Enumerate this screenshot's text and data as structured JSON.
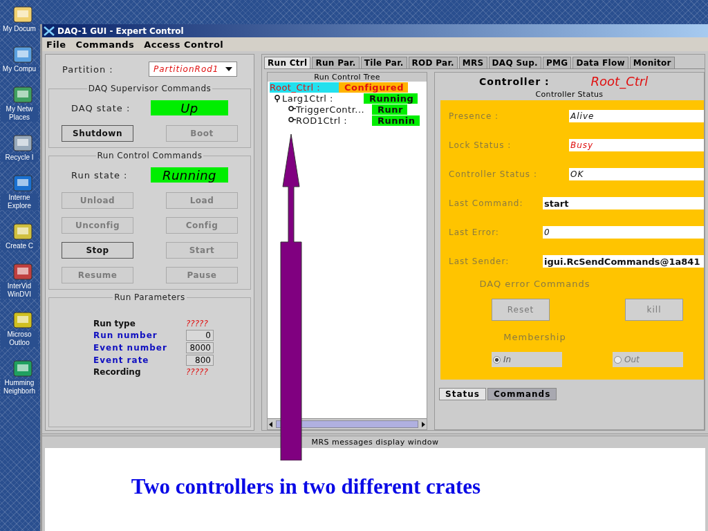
{
  "desktop_icons": [
    {
      "label": "My Docum"
    },
    {
      "label": "My Compu"
    },
    {
      "label": "My Netw Places"
    },
    {
      "label": "Recycle I"
    },
    {
      "label": "Interne Explore"
    },
    {
      "label": "Create C"
    },
    {
      "label": "InterVid WinDVI"
    },
    {
      "label": "Microso Outloo"
    },
    {
      "label": "Humming Neighborh"
    }
  ],
  "window": {
    "title": "DAQ-1 GUI - Expert Control"
  },
  "menu": [
    "File",
    "Commands",
    "Access Control"
  ],
  "partition": {
    "label": "Partition :",
    "value": "PartitionRod1"
  },
  "daq_supervisor": {
    "title": "DAQ Supervisor Commands",
    "state_label": "DAQ state :",
    "state": "Up",
    "buttons": [
      {
        "label": "Shutdown",
        "disabled": false
      },
      {
        "label": "Boot",
        "disabled": true
      }
    ]
  },
  "run_control": {
    "title": "Run Control Commands",
    "state_label": "Run state :",
    "state": "Running",
    "buttons": [
      {
        "label": "Unload",
        "disabled": true
      },
      {
        "label": "Load",
        "disabled": true
      },
      {
        "label": "Unconfig",
        "disabled": true
      },
      {
        "label": "Config",
        "disabled": true
      },
      {
        "label": "Stop",
        "disabled": false
      },
      {
        "label": "Start",
        "disabled": true
      },
      {
        "label": "Resume",
        "disabled": true
      },
      {
        "label": "Pause",
        "disabled": true
      }
    ]
  },
  "run_parameters": {
    "title": "Run Parameters",
    "rows": [
      {
        "label": "Run type",
        "value": "?????",
        "kind": "status"
      },
      {
        "label": "Run number",
        "value": "0",
        "kind": "field"
      },
      {
        "label": "Event number",
        "value": "8000",
        "kind": "field"
      },
      {
        "label": "Event rate",
        "value": "800",
        "kind": "field"
      },
      {
        "label": "Recording",
        "value": "?????",
        "kind": "status"
      }
    ]
  },
  "tabs": [
    {
      "label": "Run Ctrl",
      "selected": true
    },
    {
      "label": "Run Par.",
      "selected": false
    },
    {
      "label": "Tile Par.",
      "selected": false
    },
    {
      "label": "ROD Par.",
      "selected": false
    },
    {
      "label": "MRS",
      "selected": false
    },
    {
      "label": "DAQ Sup.",
      "selected": false
    },
    {
      "label": "PMG",
      "selected": false
    },
    {
      "label": "Data Flow",
      "selected": false
    },
    {
      "label": "Monitor",
      "selected": false
    }
  ],
  "tree": {
    "title": "Run Control Tree",
    "root": {
      "name": "Root_Ctrl :",
      "state": "Configured",
      "color": "#ffb300",
      "children": [
        {
          "name": "Larg1Ctrl :",
          "state": "Running",
          "color": "#00ee00",
          "expanded": true,
          "children": [
            {
              "name": "TriggerContr...",
              "state": "Runr",
              "color": "#00ee00",
              "expanded": false
            },
            {
              "name": "ROD1Ctrl :",
              "state": "Runnin",
              "color": "#00ee00",
              "expanded": false
            }
          ]
        }
      ]
    }
  },
  "controller": {
    "label": "Controller :",
    "name": "Root_Ctrl",
    "status_title": "Controller Status",
    "fields": [
      {
        "label": "Presence :",
        "value": "Alive",
        "kind": "italic"
      },
      {
        "label": "Lock Status :",
        "value": "Busy",
        "kind": "alert"
      },
      {
        "label": "Controller Status :",
        "value": "OK",
        "kind": "italic"
      },
      {
        "label": "Last Command:",
        "value": "start",
        "kind": "bold"
      },
      {
        "label": "Last Error:",
        "value": "0",
        "kind": "italic"
      },
      {
        "label": "Last Sender:",
        "value": "igui.RcSendCommands@1a841",
        "kind": "bold"
      }
    ],
    "error_title": "DAQ error Commands",
    "error_buttons": [
      {
        "label": "Reset",
        "disabled": true
      },
      {
        "label": "kill",
        "disabled": true
      }
    ],
    "membership_title": "Membership",
    "membership": [
      {
        "label": "In",
        "selected": true
      },
      {
        "label": "Out",
        "selected": false
      }
    ],
    "subtabs": [
      {
        "label": "Status",
        "selected": true
      },
      {
        "label": "Commands",
        "selected": false
      }
    ]
  },
  "mrs": {
    "title": "MRS messages display window"
  },
  "caption": "Two controllers in two different crates"
}
